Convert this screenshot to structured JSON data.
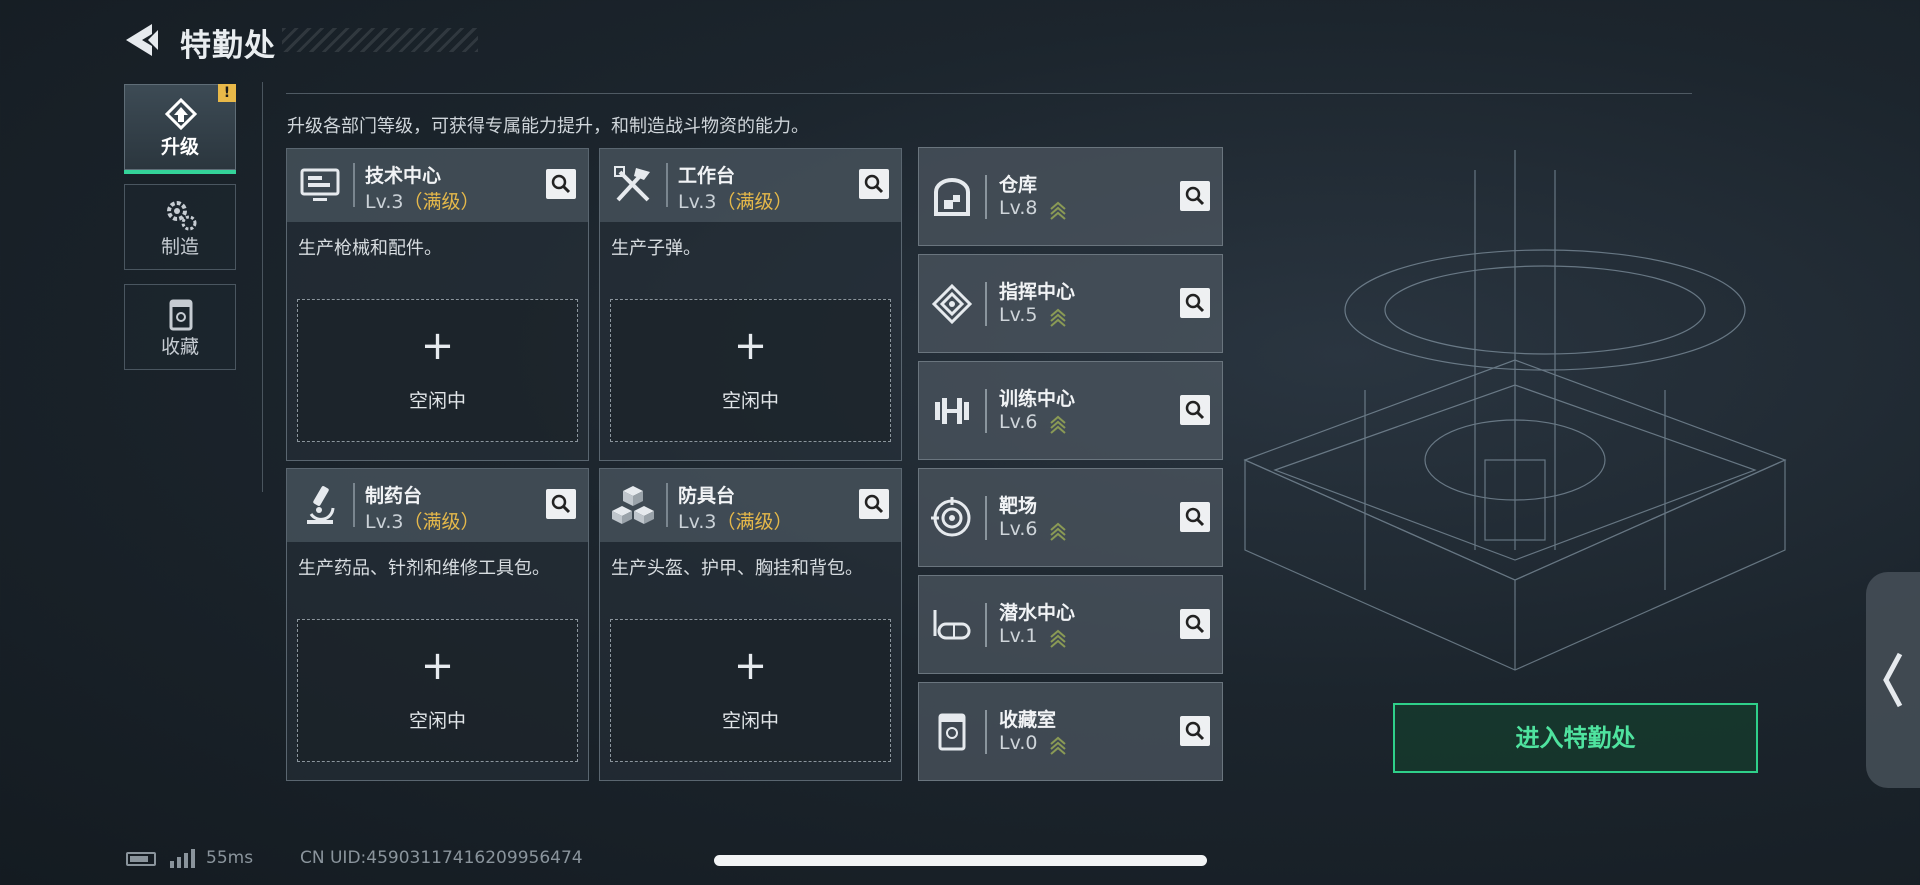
{
  "header": {
    "title": "特勤处"
  },
  "nav": {
    "items": [
      {
        "label": "升级",
        "icon": "upgrade-icon",
        "active": true,
        "badge": "!"
      },
      {
        "label": "制造",
        "icon": "gears-icon",
        "active": false
      },
      {
        "label": "收藏",
        "icon": "trophy-case-icon",
        "active": false
      }
    ]
  },
  "description": "升级各部门等级，可获得专属能力提升，和制造战斗物资的能力。",
  "departments": [
    {
      "name": "技术中心",
      "level": "Lv.3",
      "status": "（满级）",
      "desc": "生产枪械和配件。",
      "slot_label": "空闲中",
      "slot_plus": "+",
      "icon": "monitor-icon"
    },
    {
      "name": "工作台",
      "level": "Lv.3",
      "status": "（满级）",
      "desc": "生产子弹。",
      "slot_label": "空闲中",
      "slot_plus": "+",
      "icon": "tools-icon"
    },
    {
      "name": "制药台",
      "level": "Lv.3",
      "status": "（满级）",
      "desc": "生产药品、针剂和维修工具包。",
      "slot_label": "空闲中",
      "slot_plus": "+",
      "icon": "microscope-icon"
    },
    {
      "name": "防具台",
      "level": "Lv.3",
      "status": "（满级）",
      "desc": "生产头盔、护甲、胸挂和背包。",
      "slot_label": "空闲中",
      "slot_plus": "+",
      "icon": "armor-blocks-icon"
    }
  ],
  "facilities": [
    {
      "name": "仓库",
      "level": "Lv.8",
      "icon": "warehouse-icon"
    },
    {
      "name": "指挥中心",
      "level": "Lv.5",
      "icon": "command-icon"
    },
    {
      "name": "训练中心",
      "level": "Lv.6",
      "icon": "dumbbell-icon"
    },
    {
      "name": "靶场",
      "level": "Lv.6",
      "icon": "target-icon"
    },
    {
      "name": "潜水中心",
      "level": "Lv.1",
      "icon": "diving-mask-icon"
    },
    {
      "name": "收藏室",
      "level": "Lv.0",
      "icon": "display-case-icon"
    }
  ],
  "enter_button": "进入特勤处",
  "status_bar": {
    "ping": "55ms",
    "uid": "CN UID:4590311741620995647​4"
  },
  "colors": {
    "accent": "#34d399",
    "maxed": "#e5b84a",
    "warning": "#e9b949"
  }
}
